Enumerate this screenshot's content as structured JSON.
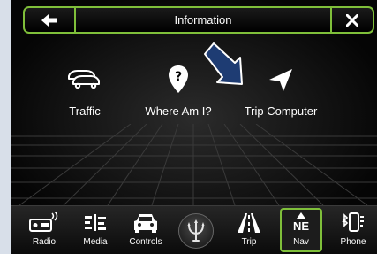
{
  "header": {
    "title": "Information",
    "back_icon": "back-arrow-icon",
    "close_icon": "close-icon"
  },
  "apps": [
    {
      "label": "Traffic",
      "icon": "traffic-cars-icon"
    },
    {
      "label": "Where Am I?",
      "icon": "location-pin-question-icon"
    },
    {
      "label": "Trip Computer",
      "icon": "navigation-arrow-icon"
    }
  ],
  "navbar": {
    "items": [
      {
        "label": "Radio",
        "icon": "radio-icon"
      },
      {
        "label": "Media",
        "icon": "media-equalizer-icon"
      },
      {
        "label": "Controls",
        "icon": "car-controls-icon"
      },
      {
        "label": "",
        "icon": "trident-logo-icon"
      },
      {
        "label": "Trip",
        "icon": "road-icon"
      },
      {
        "label": "Nav",
        "icon": "compass-icon",
        "compass_text": "NE",
        "selected": true
      },
      {
        "label": "Phone",
        "icon": "bluetooth-phone-icon"
      }
    ]
  },
  "colors": {
    "accent": "#7fbf3a",
    "callout_arrow": "#1e3c73",
    "background": "#000000"
  }
}
